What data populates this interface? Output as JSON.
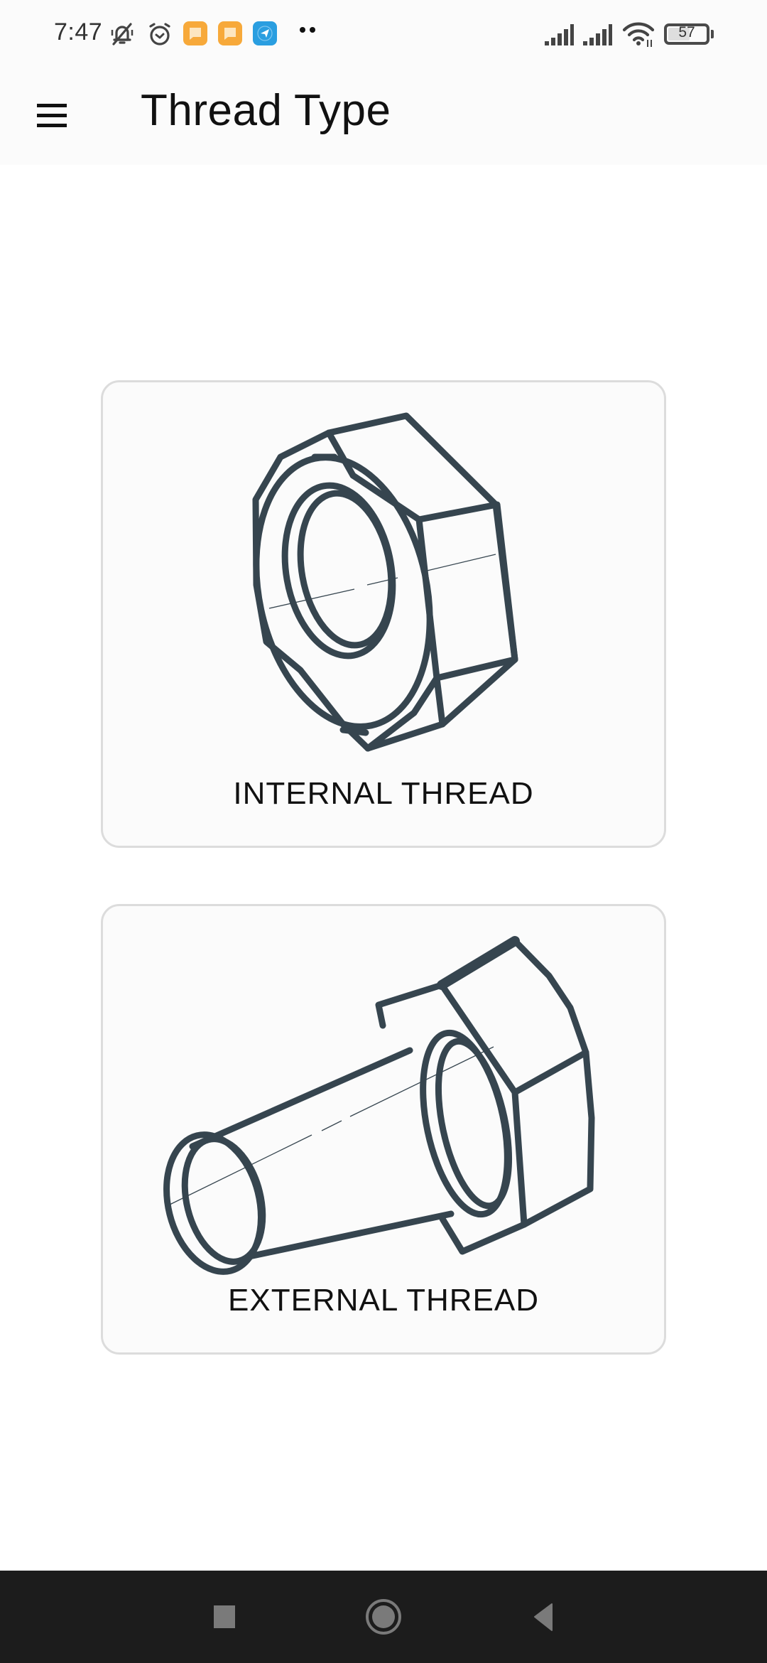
{
  "status_bar": {
    "time": "7:47",
    "icons": [
      "bell-muted-icon",
      "alarm-icon",
      "message-app-icon",
      "message-app-icon",
      "telegram-icon",
      "more-notifications-icon",
      "signal-icon",
      "signal-icon",
      "wifi-icon",
      "battery-icon"
    ],
    "battery_level": "57",
    "battery_percent": 57,
    "colors": {
      "message_app": "#f7a93a",
      "telegram": "#2a9ee0"
    }
  },
  "app_bar": {
    "menu_icon": "hamburger-menu-icon",
    "title": "Thread Type"
  },
  "options": [
    {
      "label": "INTERNAL THREAD",
      "illustration": "hex-nut-icon"
    },
    {
      "label": "EXTERNAL THREAD",
      "illustration": "hex-bolt-icon"
    }
  ],
  "colors": {
    "illustration_stroke": "#36454f",
    "card_border": "#dcdcdc",
    "card_background": "#fbfbfb",
    "nav_bar": "#1c1c1c"
  },
  "nav_bar": {
    "buttons": [
      "recents",
      "home",
      "back"
    ]
  }
}
